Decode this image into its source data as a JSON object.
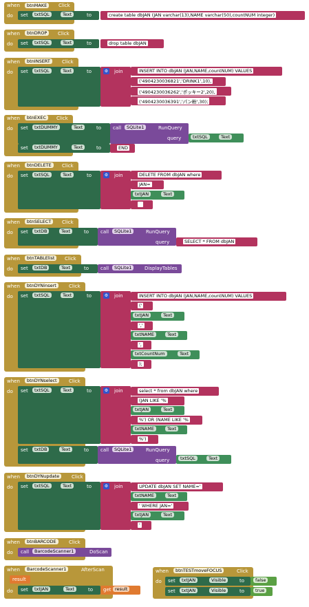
{
  "labels": {
    "when": "when",
    "do": "do",
    "set": "set",
    "to": "to",
    "call": "call",
    "join": "join",
    "query": "query",
    "get": "get",
    "result": "result"
  },
  "colors": {
    "event": "#b8973a",
    "setter": "#2e6b4a",
    "text": "#b3335e",
    "component": "#3f8f5a",
    "method": "#7a4a9a",
    "boolean": "#5aa044",
    "getter": "#e07a30"
  },
  "blocks": {
    "make": {
      "button": "btnMAKE",
      "event": "Click",
      "target": "txtSQL",
      "prop": "Text",
      "value": "create table dbJAN (JAN varchar(13),NAME varchar(50),countNUM integer)"
    },
    "drop": {
      "button": "btnDROP",
      "event": "Click",
      "target": "txtSQL",
      "prop": "Text",
      "value": "drop table dbJAN"
    },
    "insert": {
      "button": "btnINSERT",
      "event": "Click",
      "target": "txtSQL",
      "prop": "Text",
      "parts": [
        "INSERT INTO dbJAN (JAN,NAME,countNUM) VALUES",
        "('4904230036821','DRINK1',10),",
        "('4904230036262','ポッキー2',20),",
        "('4904230036391','パン粉',30);"
      ]
    },
    "exec": {
      "button": "btnEXEC",
      "event": "Click",
      "target1": "txtDUMMY",
      "prop": "Text",
      "component": "SQLite1",
      "method": "RunQuery",
      "arg": "txtSQL",
      "argprop": "Text",
      "target2": "txtDUMMY",
      "value2": "END"
    },
    "delete": {
      "button": "btnDELETE",
      "event": "Click",
      "target": "txtSQL",
      "prop": "Text",
      "part1": "DELETE FROM dbJAN where",
      "part2": "JAN=",
      "comp": "txtJAN",
      "compprop": "Text",
      "part3": ""
    },
    "select": {
      "button": "btnSELECT",
      "event": "Click",
      "target": "txtDB",
      "prop": "Text",
      "component": "SQLite1",
      "method": "RunQuery",
      "value": "SELECT * FROM dbJAN"
    },
    "tablelist": {
      "button": "btnTABLElist",
      "event": "Click",
      "target": "txtDB",
      "prop": "Text",
      "component": "SQLite1",
      "method": "DisplayTables"
    },
    "dyninsert": {
      "button": "btnDYNinsert",
      "event": "Click",
      "target": "txtSQL",
      "prop": "Text",
      "part1": "INSERT INTO dbJAN (JAN,NAME,countNUM) VALUES",
      "part2": "('",
      "c1": "txtJAN",
      "part3": "','",
      "c2": "txtNAME",
      "part4": "',",
      "c3": "txtCountNum",
      "part5": ");",
      "cprop": "Text"
    },
    "dynselect": {
      "button": "btnDYNselect",
      "event": "Click",
      "target": "txtSQL",
      "prop": "Text",
      "part1": "select * from dbJAN where",
      "part2": "(JAN LIKE '%",
      "c1": "txtJAN",
      "part3": "%') OR (NAME LIKE '%",
      "c2": "txtNAME",
      "part4": "%')",
      "cprop": "Text",
      "target2": "txtDB",
      "component": "SQLite1",
      "method": "RunQuery",
      "arg": "txtSQL"
    },
    "dynupdate": {
      "button": "btnDYNupdate",
      "event": "Click",
      "target": "txtSQL",
      "prop": "Text",
      "part1": "UPDATE dbJAN SET NAME='",
      "c1": "txtNAME",
      "part2": "' WHERE JAN='",
      "c2": "txtJAN",
      "part3": "'",
      "cprop": "Text"
    },
    "barcode": {
      "button": "btnBARCODE",
      "event": "Click",
      "component": "BarcodeScanner1",
      "method": "DoScan"
    },
    "afterscan": {
      "component": "BarcodeScanner1",
      "event": "AfterScan",
      "param": "result",
      "target": "txtJAN",
      "prop": "Text",
      "getvar": "result"
    },
    "focus": {
      "button": "btnTESTmoveFOCUS",
      "event": "Click",
      "target1": "txtJAN",
      "prop": "Visible",
      "value1": "false",
      "target2": "txtJAN",
      "value2": "true"
    }
  }
}
